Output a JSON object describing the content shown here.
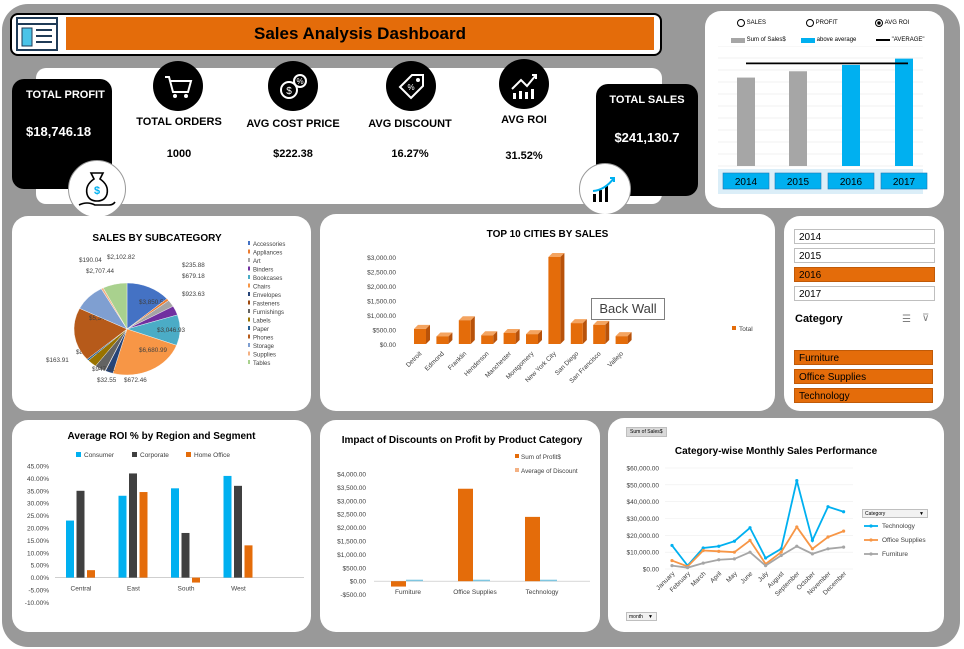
{
  "header": {
    "title": "Sales Analysis Dashboard"
  },
  "kpis": {
    "total_profit": {
      "label": "TOTAL PROFIT",
      "value": "$18,746.18"
    },
    "total_orders": {
      "label": "TOTAL ORDERS",
      "value": "1000"
    },
    "avg_cost_price": {
      "label": "AVG COST PRICE",
      "value": "$222.38"
    },
    "avg_discount": {
      "label": "AVG DISCOUNT",
      "value": "16.27%"
    },
    "avg_roi": {
      "label": "AVG ROI",
      "value": "31.52%"
    },
    "total_sales": {
      "label": "TOTAL SALES",
      "value": "$241,130.7"
    }
  },
  "year_chart": {
    "options": [
      "SALES",
      "PROFIT",
      "AVG ROI"
    ],
    "selected_option": "AVG ROI",
    "legend": [
      "Sum of Sales$",
      "above average",
      "\"AVERAGE\""
    ],
    "years": [
      "2014",
      "2015",
      "2016",
      "2017"
    ]
  },
  "slicer": {
    "years": [
      "2014",
      "2015",
      "2016",
      "2017"
    ],
    "selected_year": "2016",
    "category_title": "Category",
    "categories": [
      "Furniture",
      "Office Supplies",
      "Technology"
    ]
  },
  "subcategory_chart": {
    "title": "SALES BY SUBCATEGORY"
  },
  "cities_chart": {
    "title": "TOP 10 CITIES BY SALES",
    "back_wall_tooltip": "Back Wall"
  },
  "roi_chart": {
    "title": "Average ROI % by Region and Segment"
  },
  "discount_chart": {
    "title": "Impact of Discounts on Profit by Product Category"
  },
  "monthly_chart": {
    "title": "Category-wise Monthly Sales Performance",
    "field_button": "Sum of Sales$",
    "legend_title": "Category",
    "axis_button": "month"
  },
  "colors": {
    "orange": "#e46c0a",
    "blue": "#00b0f0",
    "grey": "#a6a6a6",
    "dark": "#404040",
    "black": "#000000"
  },
  "chart_data": [
    {
      "type": "bar",
      "id": "year_chart",
      "categories": [
        "2014",
        "2015",
        "2016",
        "2017"
      ],
      "values": [
        28,
        30,
        32,
        34
      ],
      "above_average": [
        false,
        false,
        true,
        true
      ],
      "average": 32.5,
      "ylim": [
        0,
        38
      ]
    },
    {
      "type": "pie",
      "id": "subcategory",
      "title": "SALES BY SUBCATEGORY",
      "labels": [
        "Accessories",
        "Appliances",
        "Art",
        "Binders",
        "Bookcases",
        "Chairs",
        "Envelopes",
        "Fasteners",
        "Furnishings",
        "Labels",
        "Paper",
        "Phones",
        "Storage",
        "Supplies",
        "Tables"
      ],
      "values": [
        3850.56,
        235.88,
        679.18,
        923.63,
        3046.93,
        6680.99,
        672.46,
        32.55,
        947.51,
        815.13,
        163.91,
        5341.16,
        2707.44,
        190.04,
        2102.82
      ],
      "value_labels": [
        "$3,850.56",
        "$235.88",
        "$679.18",
        "$923.63",
        "$3,046.93",
        "$6,680.99",
        "$672.46",
        "$32.55",
        "$947.51",
        "$815.13",
        "$163.91",
        "$5,341.16",
        "$2,707.44",
        "$190.04",
        "$2,102.82"
      ],
      "colors": [
        "#4472c4",
        "#ed7d31",
        "#a5a5a5",
        "#7030a0",
        "#4bacc6",
        "#f79646",
        "#264478",
        "#9e480e",
        "#636363",
        "#997300",
        "#255e91",
        "#b65a1a",
        "#7f9fd1",
        "#f4b183",
        "#a9d18e"
      ]
    },
    {
      "type": "bar",
      "id": "top_cities",
      "title": "TOP 10 CITIES BY SALES",
      "categories": [
        "Detroit",
        "Edmond",
        "Franklin",
        "Henderson",
        "Manchester",
        "Montgomery",
        "New York City",
        "San Diego",
        "San Francisco",
        "Vallejo"
      ],
      "values": [
        520,
        260,
        820,
        300,
        380,
        340,
        3000,
        720,
        660,
        270
      ],
      "yticks": [
        "$3,000.00",
        "$2,500.00",
        "$2,000.00",
        "$1,500.00",
        "$1,000.00",
        "$500.00",
        "$0.00"
      ],
      "ylim": [
        0,
        3000
      ],
      "legend": "Total"
    },
    {
      "type": "bar",
      "id": "roi_region",
      "title": "Average ROI % by Region and Segment",
      "categories": [
        "Central",
        "East",
        "South",
        "West"
      ],
      "series": [
        {
          "name": "Consumer",
          "values": [
            23,
            33,
            36,
            41
          ]
        },
        {
          "name": "Corporate",
          "values": [
            35,
            42,
            18,
            37
          ]
        },
        {
          "name": "Home Office",
          "values": [
            3,
            34.5,
            -2,
            13
          ]
        }
      ],
      "yticks": [
        "45.00%",
        "40.00%",
        "35.00%",
        "30.00%",
        "25.00%",
        "20.00%",
        "15.00%",
        "10.00%",
        "5.00%",
        "0.00%",
        "-5.00%",
        "-10.00%"
      ],
      "ylim": [
        -10,
        45
      ]
    },
    {
      "type": "bar",
      "id": "discount_profit",
      "title": "Impact of Discounts on Profit by Product Category",
      "categories": [
        "Furniture",
        "Office Supplies",
        "Technology"
      ],
      "series": [
        {
          "name": "Sum of Profit$",
          "values": [
            -200,
            3450,
            2400
          ]
        },
        {
          "name": "Average of Discount",
          "values": [
            0.2,
            0.15,
            0.14
          ]
        }
      ],
      "yticks": [
        "$4,000.00",
        "$3,500.00",
        "$3,000.00",
        "$2,500.00",
        "$2,000.00",
        "$1,500.00",
        "$1,000.00",
        "$500.00",
        "$0.00",
        "-$500.00"
      ],
      "ylim": [
        -500,
        4000
      ]
    },
    {
      "type": "line",
      "id": "monthly_sales",
      "title": "Category-wise Monthly Sales Performance",
      "x": [
        "January",
        "February",
        "March",
        "April",
        "May",
        "June",
        "July",
        "August",
        "September",
        "October",
        "November",
        "December"
      ],
      "series": [
        {
          "name": "Technology",
          "values": [
            14000,
            2000,
            12500,
            13500,
            16500,
            24500,
            6500,
            12000,
            52500,
            17000,
            37000,
            34000
          ]
        },
        {
          "name": "Office Supplies",
          "values": [
            5000,
            1500,
            11000,
            10500,
            10000,
            17000,
            3000,
            10000,
            25000,
            12000,
            19000,
            22500
          ]
        },
        {
          "name": "Furniture",
          "values": [
            2000,
            800,
            3500,
            5500,
            6000,
            10000,
            2000,
            8000,
            13500,
            9000,
            12000,
            13000
          ]
        }
      ],
      "yticks": [
        "$60,000.00",
        "$50,000.00",
        "$40,000.00",
        "$30,000.00",
        "$20,000.00",
        "$10,000.00",
        "$0.00"
      ],
      "ylim": [
        0,
        60000
      ]
    }
  ]
}
